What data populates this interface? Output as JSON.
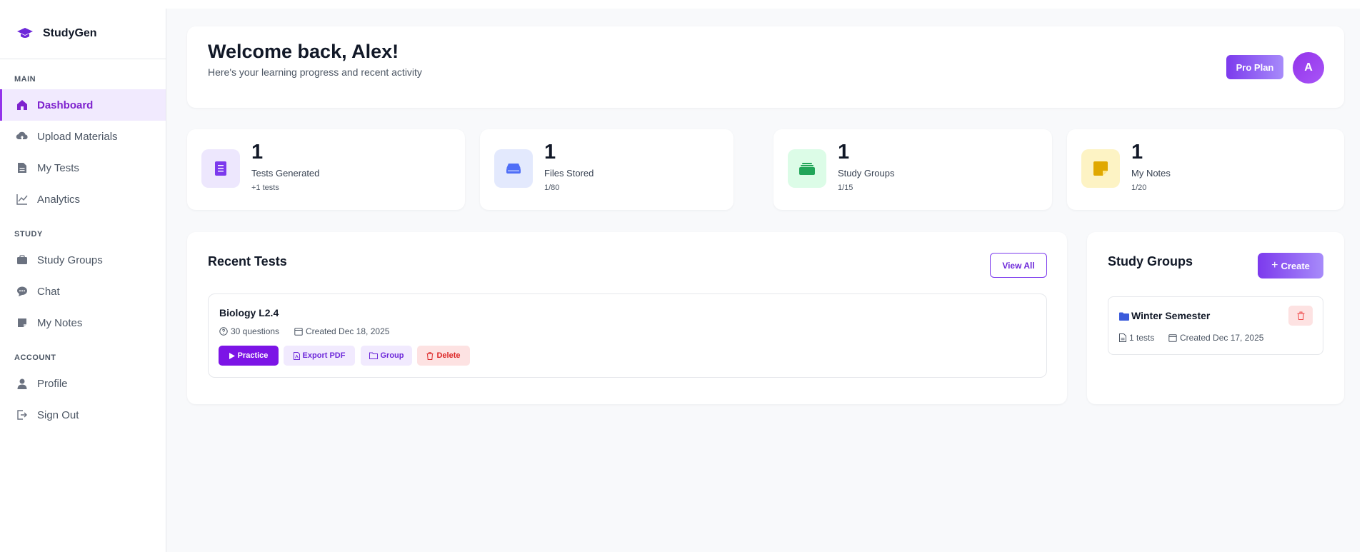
{
  "brand": {
    "name": "StudyGen",
    "icon": "graduation-cap-icon"
  },
  "sidebar": {
    "sections": [
      {
        "label": "MAIN",
        "items": [
          {
            "label": "Dashboard",
            "icon": "home-icon",
            "active": true
          },
          {
            "label": "Upload Materials",
            "icon": "cloud-upload-icon"
          },
          {
            "label": "My Tests",
            "icon": "document-icon"
          },
          {
            "label": "Analytics",
            "icon": "chart-line-icon"
          }
        ]
      },
      {
        "label": "STUDY",
        "items": [
          {
            "label": "Study Groups",
            "icon": "briefcase-icon"
          },
          {
            "label": "Chat",
            "icon": "chat-bubble-icon"
          },
          {
            "label": "My Notes",
            "icon": "sticky-note-icon"
          }
        ]
      },
      {
        "label": "ACCOUNT",
        "items": [
          {
            "label": "Profile",
            "icon": "user-icon"
          },
          {
            "label": "Sign Out",
            "icon": "sign-out-icon"
          }
        ]
      }
    ]
  },
  "header": {
    "title": "Welcome back, Alex!",
    "subtitle": "Here's your learning progress and recent activity",
    "plan_label": "Pro Plan",
    "avatar_initial": "A"
  },
  "stats": [
    {
      "value": "1",
      "label": "Tests Generated",
      "sub": "+1 tests",
      "icon": "document-icon",
      "color": "#7c3aed"
    },
    {
      "value": "1",
      "label": "Files Stored",
      "sub": "1/80",
      "icon": "hard-drive-icon",
      "color": "#4f6ef7"
    },
    {
      "value": "1",
      "label": "Study Groups",
      "sub": "1/15",
      "icon": "briefcase-icon",
      "color": "#22a559"
    },
    {
      "value": "1",
      "label": "My Notes",
      "sub": "1/20",
      "icon": "sticky-note-icon",
      "color": "#e0a800"
    }
  ],
  "recent_tests": {
    "title": "Recent Tests",
    "view_all_label": "View All",
    "items": [
      {
        "name": "Biology L2.4",
        "questions": "30 questions",
        "created": "Created Dec 18, 2025",
        "actions": {
          "practice": "Practice",
          "export": "Export PDF",
          "group": "Group",
          "delete": "Delete"
        }
      }
    ]
  },
  "study_groups": {
    "title": "Study Groups",
    "create_label": "Create",
    "items": [
      {
        "name": "Winter Semester",
        "tests": "1 tests",
        "created": "Created Dec 17, 2025"
      }
    ]
  },
  "colors": {
    "accent": "#7c3aed",
    "danger": "#dc2626"
  }
}
